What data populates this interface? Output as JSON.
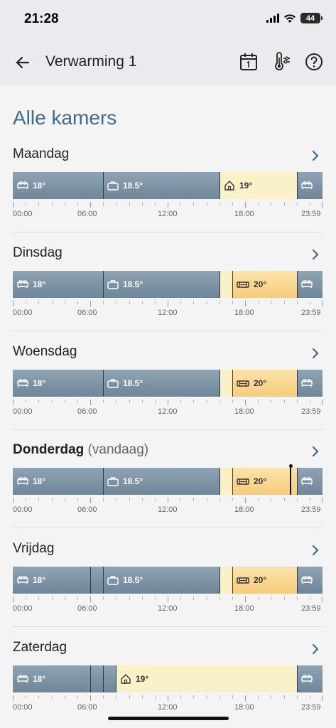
{
  "status_bar": {
    "time": "21:28",
    "battery": "44"
  },
  "header": {
    "title": "Verwarming 1"
  },
  "page_title": "Alle kamers",
  "time_labels": [
    "00:00",
    "06:00",
    "12:00",
    "18:00",
    "23:59"
  ],
  "colors": {
    "night": "#7b90a1",
    "away": "#fbf1c8",
    "home": "#f6cc7b",
    "title": "#3f6c8a"
  },
  "days": [
    {
      "name": "Maandag",
      "suffix": "",
      "segments": [
        {
          "kind": "night",
          "icon": "bed-icon",
          "label": "18°"
        },
        {
          "kind": "away",
          "icon": "briefcase-icon",
          "label": "18.5°"
        },
        {
          "kind": "cream",
          "icon": "home-icon",
          "label": "19°"
        },
        {
          "kind": "night",
          "icon": "bed-icon",
          "label": ""
        }
      ]
    },
    {
      "name": "Dinsdag",
      "suffix": "",
      "segments": [
        {
          "kind": "night",
          "icon": "bed-icon",
          "label": "18°"
        },
        {
          "kind": "away",
          "icon": "briefcase-icon",
          "label": "18.5°"
        },
        {
          "kind": "cream",
          "icon": "",
          "label": ""
        },
        {
          "kind": "orange",
          "icon": "sofa-icon",
          "label": "20°"
        },
        {
          "kind": "night",
          "icon": "bed-icon",
          "label": ""
        }
      ]
    },
    {
      "name": "Woensdag",
      "suffix": "",
      "segments": [
        {
          "kind": "night",
          "icon": "bed-icon",
          "label": "18°"
        },
        {
          "kind": "away",
          "icon": "briefcase-icon",
          "label": "18.5°"
        },
        {
          "kind": "cream",
          "icon": "",
          "label": ""
        },
        {
          "kind": "orange",
          "icon": "sofa-icon",
          "label": "20°"
        },
        {
          "kind": "night",
          "icon": "bed-icon",
          "label": ""
        }
      ]
    },
    {
      "name": "Donderdag",
      "suffix": "(vandaag)",
      "segments": [
        {
          "kind": "night",
          "icon": "bed-icon",
          "label": "18°"
        },
        {
          "kind": "away",
          "icon": "briefcase-icon",
          "label": "18.5°"
        },
        {
          "kind": "cream",
          "icon": "",
          "label": ""
        },
        {
          "kind": "orange",
          "icon": "sofa-icon",
          "label": "20°"
        },
        {
          "kind": "night",
          "icon": "bed-icon",
          "label": ""
        }
      ],
      "now": true
    },
    {
      "name": "Vrijdag",
      "suffix": "",
      "segments": [
        {
          "kind": "night",
          "icon": "bed-icon",
          "label": "18°"
        },
        {
          "kind": "night",
          "icon": "",
          "label": ""
        },
        {
          "kind": "away",
          "icon": "briefcase-icon",
          "label": "18.5°"
        },
        {
          "kind": "cream",
          "icon": "",
          "label": ""
        },
        {
          "kind": "orange",
          "icon": "sofa-icon",
          "label": "20°"
        },
        {
          "kind": "night",
          "icon": "bed-icon",
          "label": ""
        }
      ]
    },
    {
      "name": "Zaterdag",
      "suffix": "",
      "segments": [
        {
          "kind": "night",
          "icon": "bed-icon",
          "label": "18°"
        },
        {
          "kind": "night",
          "icon": "",
          "label": ""
        },
        {
          "kind": "night",
          "icon": "",
          "label": ""
        },
        {
          "kind": "cream",
          "icon": "home-icon",
          "label": "19°"
        },
        {
          "kind": "night",
          "icon": "bed-icon",
          "label": ""
        }
      ]
    }
  ]
}
